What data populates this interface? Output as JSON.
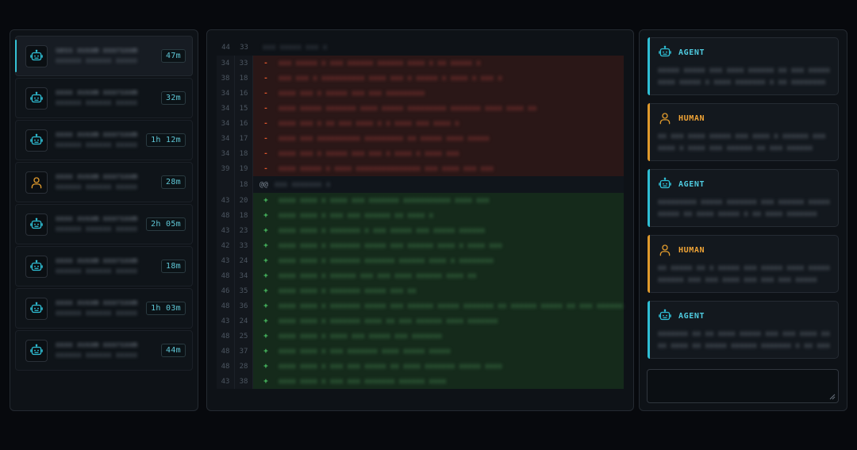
{
  "colors": {
    "accent_agent": "#2fbfd5",
    "accent_human": "#e09a2c",
    "diff_removed_bg": "#2a1717",
    "diff_added_bg": "#152a1b",
    "duration_text": "#5fc7d6"
  },
  "sessions": [
    {
      "icon": "robot-icon",
      "title": "sess xvxxm xxxrsxxm",
      "subtitle": "xxxxxx xxxxxx xxxxx",
      "duration": "47m",
      "active": true
    },
    {
      "icon": "robot-icon",
      "title": "xxxx xvxxm xxxrsxxm",
      "subtitle": "xxxxxx xxxxxx xxxxx",
      "duration": "32m",
      "active": false
    },
    {
      "icon": "robot-icon",
      "title": "xxxx xvxxm xxxrsxxm",
      "subtitle": "xxxxxx xxxxxx xxxxx",
      "duration": "1h 12m",
      "active": false
    },
    {
      "icon": "person-icon",
      "title": "xxxx xvxxm xxxrsxxm",
      "subtitle": "xxxxxx xxxxxx xxxxx",
      "duration": "28m",
      "active": false
    },
    {
      "icon": "robot-icon",
      "title": "xxxx xvxxm xxxrsxxm",
      "subtitle": "xxxxxx xxxxxx xxxxx",
      "duration": "2h 05m",
      "active": false
    },
    {
      "icon": "robot-icon",
      "title": "xxxx xvxxm xxxrsxxm",
      "subtitle": "xxxxxx xxxxxx xxxxx",
      "duration": "18m",
      "active": false
    },
    {
      "icon": "robot-icon",
      "title": "xxxx xvxxm xxxrsxxm",
      "subtitle": "xxxxxx xxxxxx xxxxx",
      "duration": "1h 03m",
      "active": false
    },
    {
      "icon": "robot-icon",
      "title": "xxxx xvxxm xxxrsxxm",
      "subtitle": "xxxxxx xxxxxx xxxxx",
      "duration": "44m",
      "active": false
    }
  ],
  "diff": {
    "header": {
      "old": "44",
      "new": "33",
      "text": "xxx xxxxx xxx x"
    },
    "removed": [
      {
        "old": "34",
        "new": "33",
        "sign": "-",
        "code": "xxx xxxxx x xxx xxxxxx xxxxxx xxxx x xx xxxxx x"
      },
      {
        "old": "38",
        "new": "18",
        "sign": "-",
        "code": "xxx xxx x xxxxxxxxxx xxxx xxx x xxxxx x xxxx x xxx x"
      },
      {
        "old": "34",
        "new": "16",
        "sign": "-",
        "code": "xxxx xxx x xxxxx xxx xxx xxxxxxxxx"
      },
      {
        "old": "34",
        "new": "15",
        "sign": "-",
        "code": "xxxx xxxxx xxxxxxx xxxx xxxxx xxxxxxxxx xxxxxxx xxxx xxxx xx"
      },
      {
        "old": "34",
        "new": "16",
        "sign": "-",
        "code": "xxxx xxx x xx xxx xxxx x x xxxx xxx xxxx x"
      },
      {
        "old": "34",
        "new": "17",
        "sign": "-",
        "code": "xxxx xxx xxxxxxxxxx xxxxxxxxx xx xxxxx xxxx xxxxx"
      },
      {
        "old": "34",
        "new": "18",
        "sign": "-",
        "code": "xxxx xxx x xxxxx xxx xxx x xxxx x xxxx xxx"
      },
      {
        "old": "39",
        "new": "19",
        "sign": "-",
        "code": "xxxx xxxxx x xxxx xxxxxxxxxxxxxxx xxx xxxx xxx xxx"
      }
    ],
    "hunk": {
      "new": "18",
      "marker": "@@",
      "text": "xxx xxxxxxx x"
    },
    "added": [
      {
        "old": "43",
        "new": "20",
        "sign": "+",
        "code": "xxxx xxxx x xxxx xxx xxxxxxx xxxxxxxxxxx xxxx xxx"
      },
      {
        "old": "48",
        "new": "18",
        "sign": "+",
        "code": "xxxx xxxx x xxx xxx xxxxxx xx xxxx x"
      },
      {
        "old": "43",
        "new": "23",
        "sign": "+",
        "code": "xxxx xxxx x xxxxxxx x xxx xxxxx xxx xxxxx xxxxxx"
      },
      {
        "old": "42",
        "new": "33",
        "sign": "+",
        "code": "xxxx xxxx x xxxxxxx xxxxx xxx xxxxxx xxxx x xxxx xxx"
      },
      {
        "old": "43",
        "new": "24",
        "sign": "+",
        "code": "xxxx xxxx x xxxxxxx xxxxxxx xxxxxx xxxx x xxxxxxxx"
      },
      {
        "old": "48",
        "new": "34",
        "sign": "+",
        "code": "xxxx xxxx x xxxxxx xxx xxx xxxx xxxxxx xxxx xx"
      },
      {
        "old": "46",
        "new": "35",
        "sign": "+",
        "code": "xxxx xxxx x xxxxxxx xxxxx xxx xx"
      },
      {
        "old": "48",
        "new": "36",
        "sign": "+",
        "code": "xxxx xxxx x xxxxxxx xxxxx xxx xxxxxx xxxxx xxxxxxx xx xxxxxx xxxxx xx xxx xxxxxxx xxxxx xxx"
      },
      {
        "old": "43",
        "new": "24",
        "sign": "+",
        "code": "xxxx xxxx x xxxxxxx xxxx xx xxx xxxxxx xxxx xxxxxxx"
      },
      {
        "old": "48",
        "new": "25",
        "sign": "+",
        "code": "xxxx xxxx x xxxx xxx xxxxx xxx xxxxxxx"
      },
      {
        "old": "48",
        "new": "37",
        "sign": "+",
        "code": "xxxx xxxx x xxx xxxxxxx xxxx xxxxx xxxxx"
      },
      {
        "old": "48",
        "new": "28",
        "sign": "+",
        "code": "xxxx xxxx x xxx xxx xxxxx xx xxxx xxxxxxx xxxxx xxxx"
      },
      {
        "old": "43",
        "new": "38",
        "sign": "+",
        "code": "xxxx xxxx x xxx xxx xxxxxxx xxxxxx xxxx"
      }
    ]
  },
  "chat": [
    {
      "role": "AGENT",
      "icon": "robot-icon",
      "lines": [
        "xxxxx xxxxx xxx xxxx xxxxxx xx xxx xxxxx xxxxx xxx xxx",
        "xxxx xxxxx x xxxx xxxxxxx x xx xxxxxxxx"
      ]
    },
    {
      "role": "HUMAN",
      "icon": "person-icon",
      "lines": [
        "xx xxx xxxx xxxxx xxx xxxx x xxxxxx xxx xxxx xxxx",
        "xxxx x xxxx xxx xxxxxx xx xxx xxxxxx"
      ]
    },
    {
      "role": "AGENT",
      "icon": "robot-icon",
      "lines": [
        "xxxxxxxxx xxxxx xxxxxxx xxx xxxxxx xxxxxxxx xxxxx",
        "xxxxx xx xxxx xxxxx x xx xxxx xxxxxxx"
      ]
    },
    {
      "role": "HUMAN",
      "icon": "person-icon",
      "lines": [
        "xx xxxxx xx x xxxxx xxx xxxxx xxxx xxxxxxxx xxxxx",
        "xxxxxx xxx xxx xxxx xxx xxx xxx xxxxx"
      ]
    },
    {
      "role": "AGENT",
      "icon": "robot-icon",
      "lines": [
        "xxxxxxx xx xx xxxx xxxxx xxx xxx xxxx xxxxx xx",
        "xx xxxx xx xxxxx xxxxxx xxxxxxx x xx xxx"
      ]
    }
  ],
  "composer": {
    "placeholder": ""
  }
}
